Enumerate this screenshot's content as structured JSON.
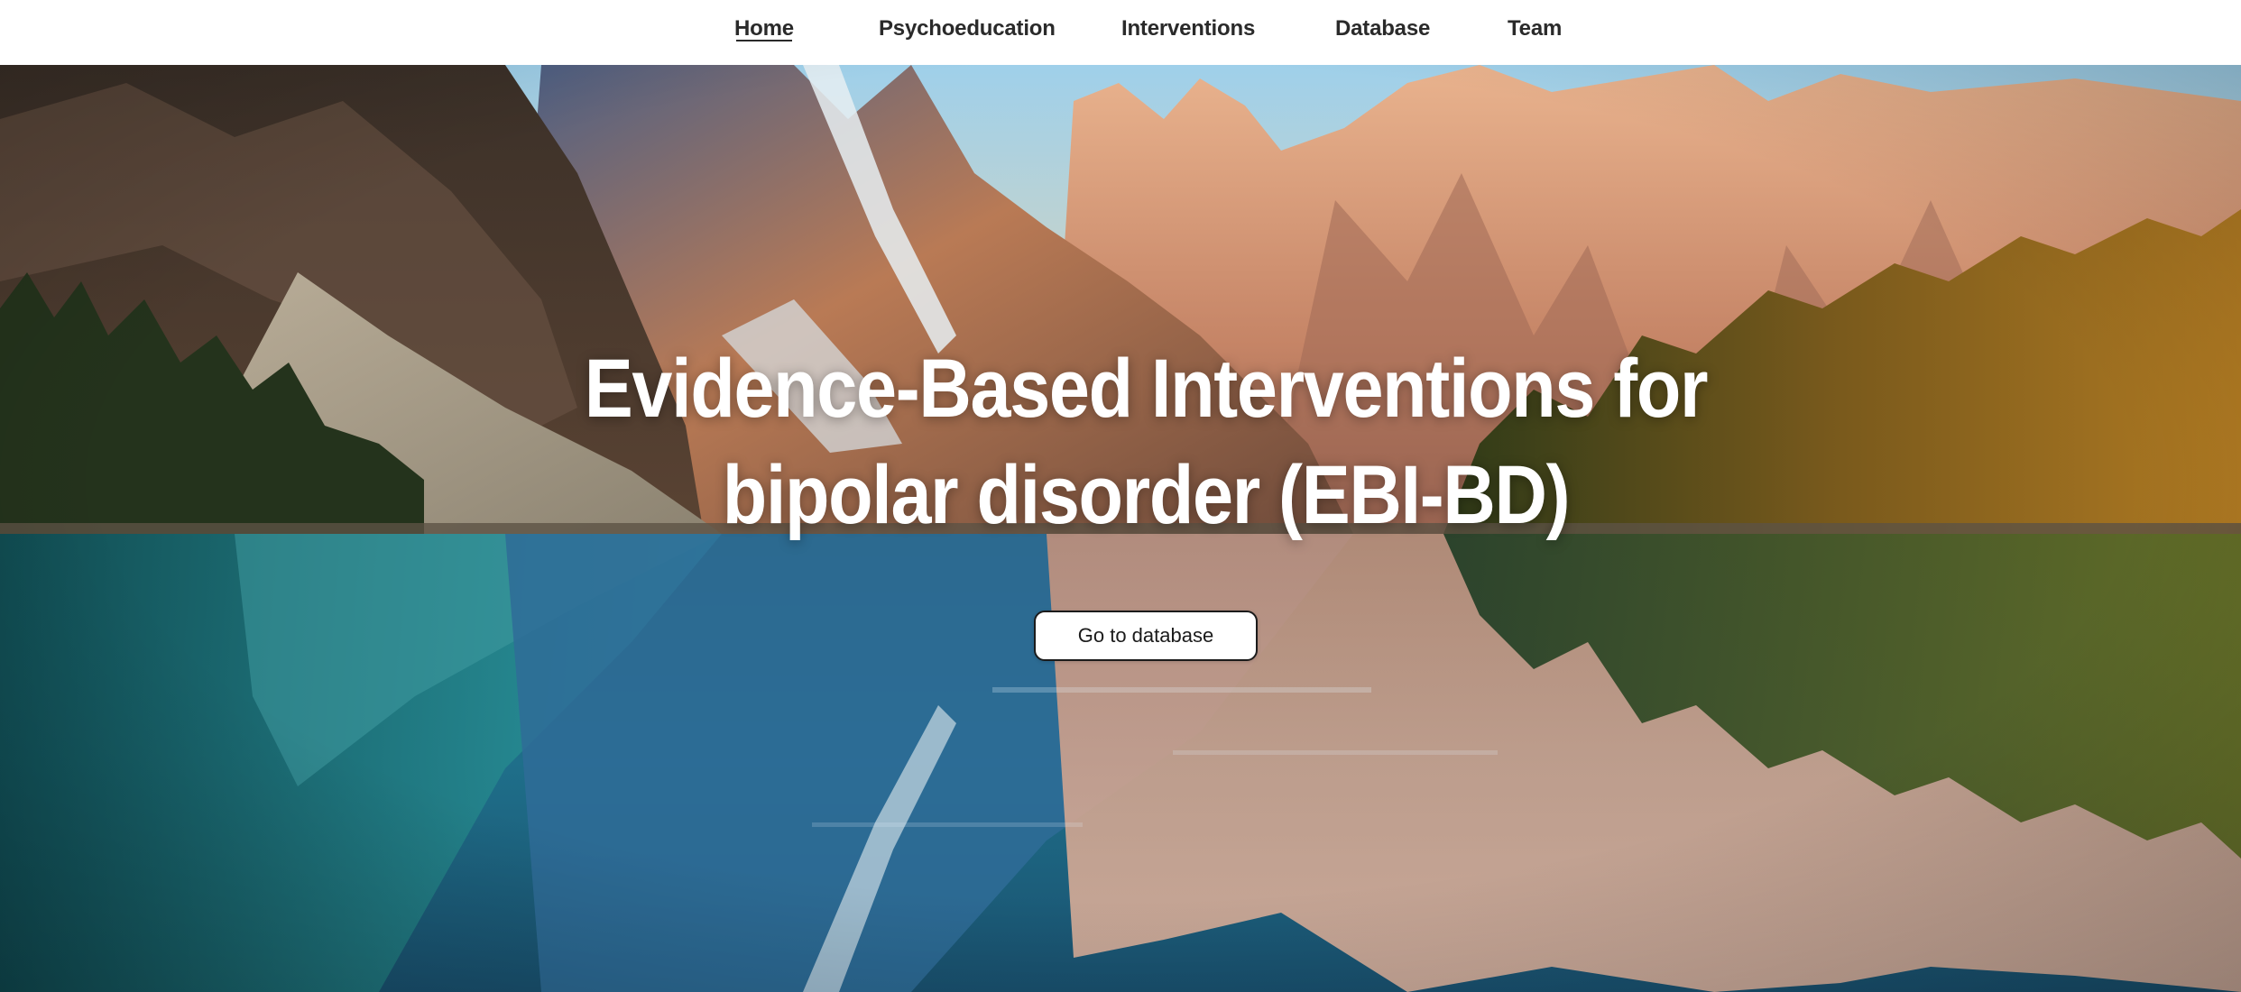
{
  "nav": {
    "items": [
      {
        "label": "Home",
        "active": true
      },
      {
        "label": "Psychoeducation",
        "active": false
      },
      {
        "label": "Interventions",
        "active": false
      },
      {
        "label": "Database",
        "active": false
      },
      {
        "label": "Team",
        "active": false
      }
    ]
  },
  "hero": {
    "title_line1": "Evidence-Based Interventions for",
    "title_line2": "bipolar disorder (EBI-BD)",
    "button_label": "Go to database",
    "background": "mountain-lake-reflection-image"
  },
  "colors": {
    "nav_bg": "#ffffff",
    "nav_text": "#2a2a2a",
    "title_text": "#ffffff",
    "button_bg": "#ffffff",
    "button_border": "#1b1b1b"
  }
}
